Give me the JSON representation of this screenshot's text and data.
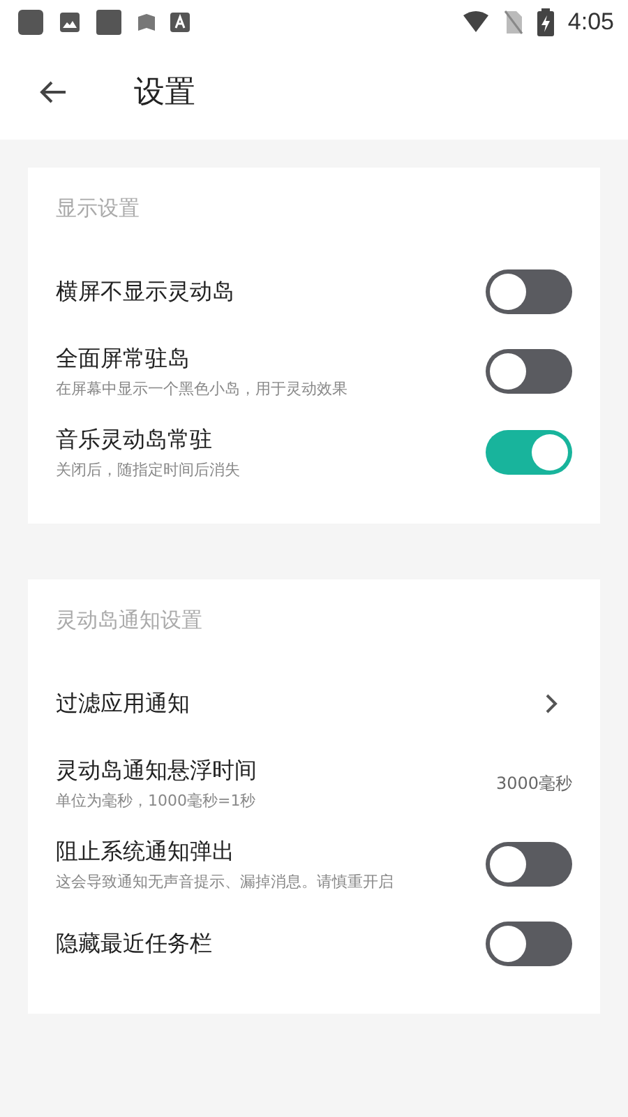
{
  "status_bar": {
    "time": "4:05"
  },
  "header": {
    "title": "设置"
  },
  "sections": [
    {
      "title": "显示设置",
      "items": [
        {
          "kind": "switch",
          "title": "横屏不显示灵动岛",
          "on": false
        },
        {
          "kind": "switch",
          "title": "全面屏常驻岛",
          "subtitle": "在屏幕中显示一个黑色小岛，用于灵动效果",
          "on": false
        },
        {
          "kind": "switch",
          "title": "音乐灵动岛常驻",
          "subtitle": "关闭后，随指定时间后消失",
          "on": true
        }
      ]
    },
    {
      "title": "灵动岛通知设置",
      "items": [
        {
          "kind": "link",
          "title": "过滤应用通知"
        },
        {
          "kind": "value",
          "title": "灵动岛通知悬浮时间",
          "subtitle": "单位为毫秒，1000毫秒=1秒",
          "value": "3000毫秒"
        },
        {
          "kind": "switch",
          "title": "阻止系统通知弹出",
          "subtitle": "这会导致通知无声音提示、漏掉消息。请慎重开启",
          "on": false
        },
        {
          "kind": "switch",
          "title": "隐藏最近任务栏",
          "on": false
        }
      ]
    }
  ]
}
